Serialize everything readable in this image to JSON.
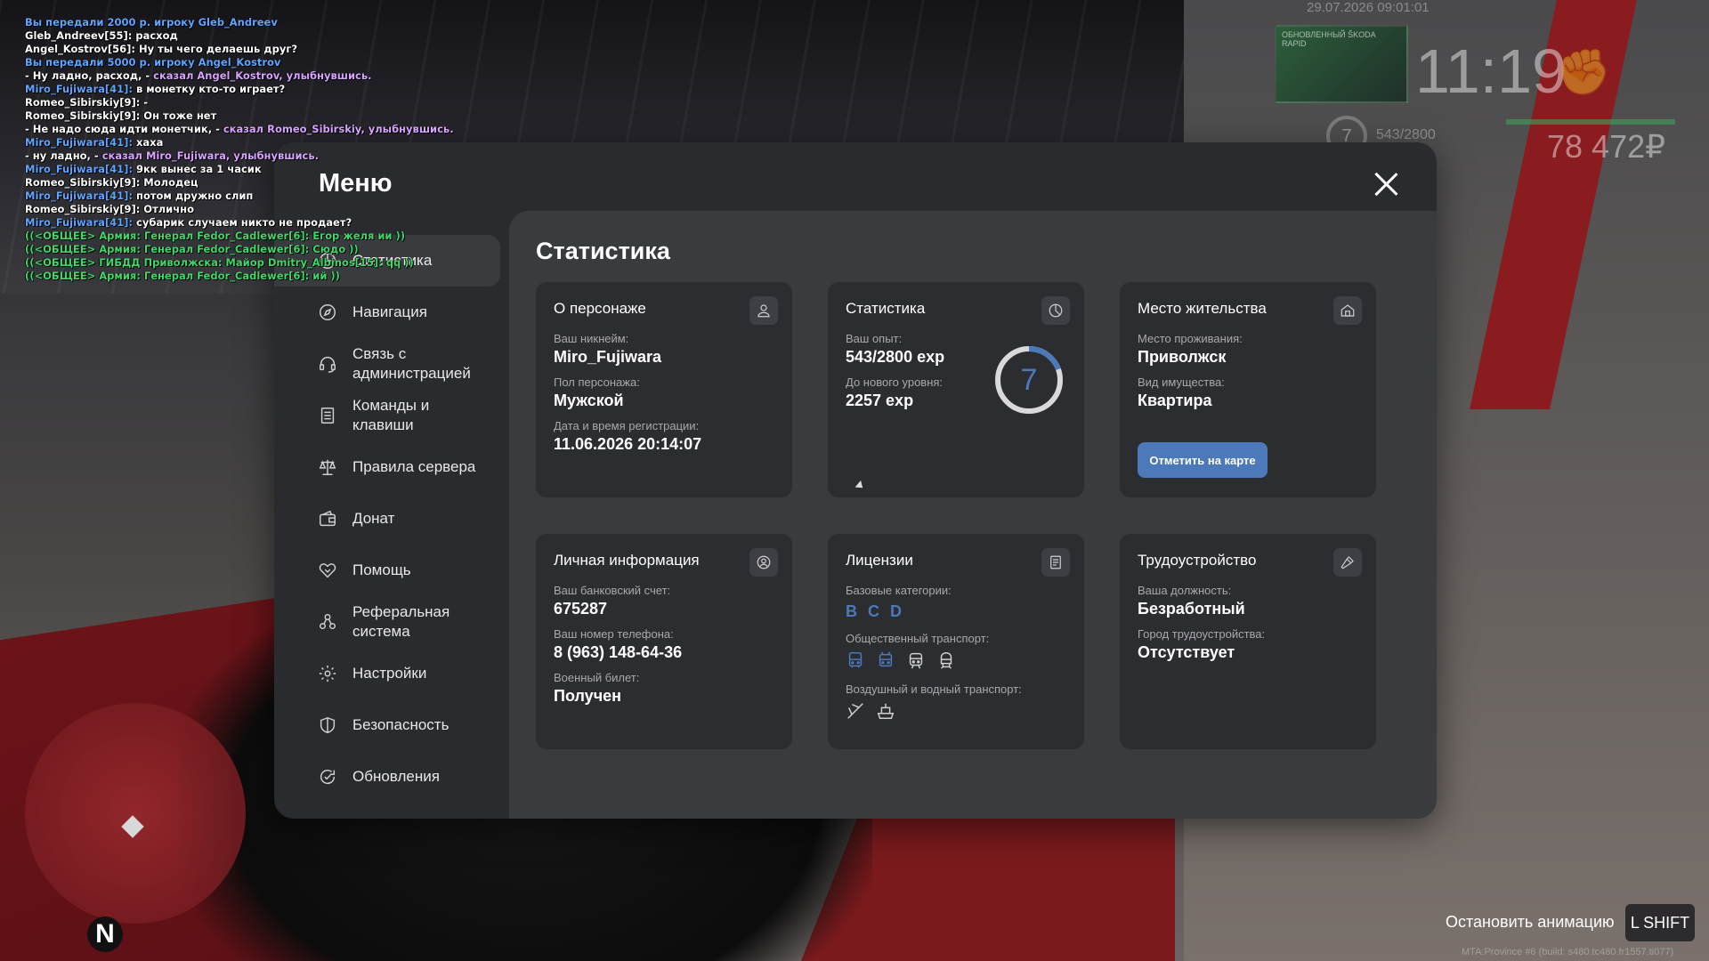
{
  "chat": [
    {
      "parts": [
        {
          "t": "Вы передали 2000 р. игроку Gleb_Andreev",
          "c": "blue"
        }
      ]
    },
    {
      "parts": [
        {
          "t": "Gleb_Andreev[55]: расход",
          "c": "white"
        }
      ]
    },
    {
      "parts": [
        {
          "t": "Angel_Kostrov[56]: Ну ты чего делаешь друг?",
          "c": "white"
        }
      ]
    },
    {
      "parts": [
        {
          "t": "Вы передали 5000 р. игроку Angel_Kostrov",
          "c": "blue"
        }
      ]
    },
    {
      "parts": [
        {
          "t": " - Ну ладно, расход, - ",
          "c": "white"
        },
        {
          "t": "сказал Angel_Kostrov, улыбнувшись.",
          "c": "purple"
        }
      ]
    },
    {
      "parts": [
        {
          "t": "Miro_Fujiwara[41]:",
          "c": "name"
        },
        {
          "t": " в монетку кто-то играет?",
          "c": "white"
        }
      ]
    },
    {
      "parts": [
        {
          "t": "Romeo_Sibirskiy[9]: -",
          "c": "white"
        }
      ]
    },
    {
      "parts": [
        {
          "t": "Romeo_Sibirskiy[9]: Он тоже нет",
          "c": "white"
        }
      ]
    },
    {
      "parts": [
        {
          "t": " - Не надо сюда идти монетчик, - ",
          "c": "white"
        },
        {
          "t": "сказал Romeo_Sibirskiy, улыбнувшись.",
          "c": "purple"
        }
      ]
    },
    {
      "parts": [
        {
          "t": "Miro_Fujiwara[41]:",
          "c": "name"
        },
        {
          "t": " хаха",
          "c": "white"
        }
      ]
    },
    {
      "parts": [
        {
          "t": " - ну ладно, - ",
          "c": "white"
        },
        {
          "t": "сказал Miro_Fujiwara, улыбнувшись.",
          "c": "purple"
        }
      ]
    },
    {
      "parts": [
        {
          "t": "Miro_Fujiwara[41]:",
          "c": "name"
        },
        {
          "t": " 9кк вынес за 1 часик",
          "c": "white"
        }
      ]
    },
    {
      "parts": [
        {
          "t": "Romeo_Sibirskiy[9]: Молодец",
          "c": "white"
        }
      ]
    },
    {
      "parts": [
        {
          "t": "Miro_Fujiwara[41]:",
          "c": "name"
        },
        {
          "t": " потом дружно слип",
          "c": "white"
        }
      ]
    },
    {
      "parts": [
        {
          "t": "Romeo_Sibirskiy[9]: Отлично",
          "c": "white"
        }
      ]
    },
    {
      "parts": [
        {
          "t": "Miro_Fujiwara[41]:",
          "c": "name"
        },
        {
          "t": " субарик случаем никто не продает?",
          "c": "white"
        }
      ]
    },
    {
      "parts": [
        {
          "t": "((<ОБЩЕЕ> Армия: Генерал Fedor_Cadlewer[6]: Егор желя ии ))",
          "c": "green"
        }
      ]
    },
    {
      "parts": [
        {
          "t": "((<ОБЩЕЕ> Армия: Генерал Fedor_Cadlewer[6]: Сюдо ))",
          "c": "green"
        }
      ]
    },
    {
      "parts": [
        {
          "t": "((<ОБЩЕЕ> ГИБДД Приволжска: Майор Dmitry_Albinos[15]: qq ))",
          "c": "green"
        }
      ]
    },
    {
      "parts": [
        {
          "t": "((<ОБЩЕЕ> Армия: Генерал Fedor_Cadlewer[6]: ий ))",
          "c": "green"
        }
      ]
    }
  ],
  "hud": {
    "date": "29.07.2026 09:01:01",
    "time": "11:19",
    "ad_text": "ОБНОВЛЕННЫЙ ŠKODA RAPID",
    "level": "7",
    "exp": "543/2800",
    "money": "78 472₽"
  },
  "footer": {
    "stop_animation": "Остановить анимацию",
    "key": "L SHIFT",
    "build": "MTA:Province #6 (build: s480.tc480.fr1557.ti077)",
    "compass": "N"
  },
  "menu": {
    "title": "Меню",
    "sidebar": [
      {
        "label": "Статистика",
        "icon": "statistics-icon"
      },
      {
        "label": "Навигация",
        "icon": "compass-icon"
      },
      {
        "label": "Связь с администрацией",
        "icon": "headset-icon"
      },
      {
        "label": "Команды и клавиши",
        "icon": "document-icon"
      },
      {
        "label": "Правила сервера",
        "icon": "scales-icon"
      },
      {
        "label": "Донат",
        "icon": "wallet-icon"
      },
      {
        "label": "Помощь",
        "icon": "handshake-icon"
      },
      {
        "label": "Реферальная система",
        "icon": "referral-icon"
      },
      {
        "label": "Настройки",
        "icon": "gear-icon"
      },
      {
        "label": "Безопасность",
        "icon": "shield-icon"
      },
      {
        "label": "Обновления",
        "icon": "refresh-icon"
      }
    ],
    "content_title": "Статистика",
    "character": {
      "title": "О персонаже",
      "nick_label": "Ваш никнейм:",
      "nick": "Miro_Fujiwara",
      "gender_label": "Пол персонажа:",
      "gender": "Мужской",
      "reg_label": "Дата и время регистрации:",
      "reg": "11.06.2026 20:14:07"
    },
    "stats": {
      "title": "Статистика",
      "exp_label": "Ваш опыт:",
      "exp": "543/2800 exp",
      "next_label": "До нового уровня:",
      "next": "2257 exp",
      "level": "7",
      "progress": 0.194
    },
    "residence": {
      "title": "Место жительства",
      "place_label": "Место проживания:",
      "place": "Приволжск",
      "property_label": "Вид имущества:",
      "property": "Квартира",
      "map_button": "Отметить на карте"
    },
    "personal": {
      "title": "Личная информация",
      "bank_label": "Ваш банковский счет:",
      "bank": "675287",
      "phone_label": "Ваш номер телефона:",
      "phone": "8 (963) 148-64-36",
      "military_label": "Военный билет:",
      "military": "Получен"
    },
    "licenses": {
      "title": "Лицензии",
      "base_label": "Базовые категории:",
      "base": [
        "B",
        "C",
        "D"
      ],
      "public_label": "Общественный транспорт:",
      "public": [
        "bus-icon",
        "trolleybus-icon",
        "tram-icon",
        "train-icon"
      ],
      "air_label": "Воздушный и водный транспорт:",
      "air": [
        "plane-icon",
        "boat-icon"
      ]
    },
    "employment": {
      "title": "Трудоустройство",
      "position_label": "Ваша должность:",
      "position": "Безработный",
      "city_label": "Город трудоустройства:",
      "city": "Отсутствует"
    }
  }
}
